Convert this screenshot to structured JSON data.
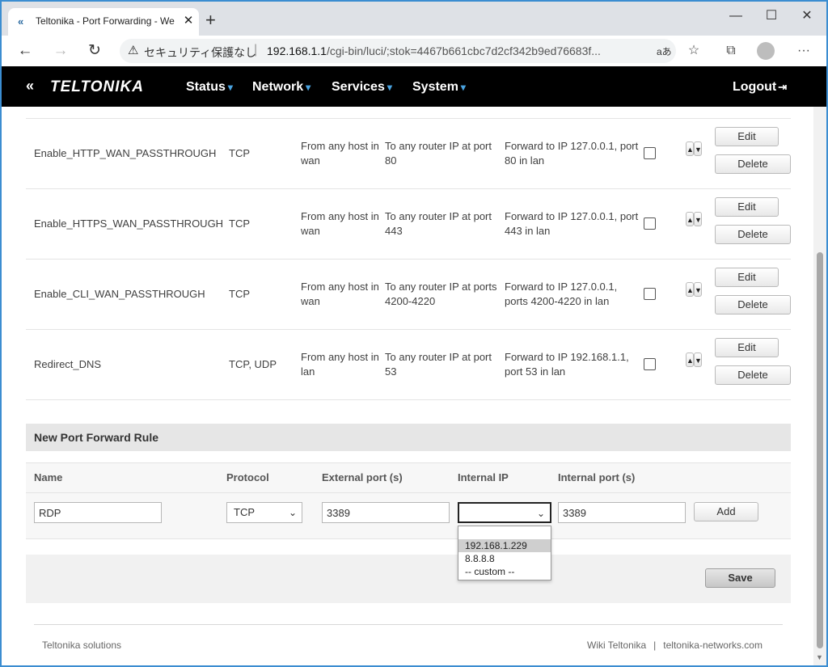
{
  "browser": {
    "tab_title": "Teltonika - Port Forwarding - We",
    "tab_close": "✕",
    "new_tab": "+",
    "window_minimize": "—",
    "window_maximize": "☐",
    "window_close": "✕",
    "nav_back": "←",
    "nav_forward": "→",
    "nav_reload": "↻",
    "security_warning": "⚠",
    "security_text": "セキュリティ保護なし",
    "address_separator": "|",
    "url_host": "192.168.1.1",
    "url_path": "/cgi-bin/luci/;stok=4467b661cbc7d2cf342b9ed76683f...",
    "read_aloud": "aあ",
    "favorites_icon": "☆",
    "collections_icon": "⧉",
    "more_icon": "···"
  },
  "router": {
    "logo_mark": "«",
    "logo": "TELTONIKA",
    "menu": [
      {
        "label": "Status"
      },
      {
        "label": "Network"
      },
      {
        "label": "Services"
      },
      {
        "label": "System"
      }
    ],
    "menu_caret": "▾",
    "logout": "Logout"
  },
  "rules": [
    {
      "name": "Enable_HTTP_WAN_PASSTHROUGH",
      "protocol": "TCP",
      "source": "From any host in wan",
      "destination": "To any router IP at port 80",
      "forward": "Forward to IP 127.0.0.1, port 80 in lan"
    },
    {
      "name": "Enable_HTTPS_WAN_PASSTHROUGH",
      "protocol": "TCP",
      "source": "From any host in wan",
      "destination": "To any router IP at port 443",
      "forward": "Forward to IP 127.0.0.1, port 443 in lan"
    },
    {
      "name": "Enable_CLI_WAN_PASSTHROUGH",
      "protocol": "TCP",
      "source": "From any host in wan",
      "destination": "To any router IP at ports 4200-4220",
      "forward": "Forward to IP 127.0.0.1, ports 4200-4220 in lan"
    },
    {
      "name": "Redirect_DNS",
      "protocol": "TCP, UDP",
      "source": "From any host in lan",
      "destination": "To any router IP at port 53",
      "forward": "Forward to IP 192.168.1.1, port 53 in lan"
    }
  ],
  "rule_buttons": {
    "edit": "Edit",
    "delete": "Delete",
    "up": "▲",
    "down": "▼"
  },
  "new_rule": {
    "title": "New Port Forward Rule",
    "headers": {
      "name": "Name",
      "protocol": "Protocol",
      "external_port": "External port (s)",
      "internal_ip": "Internal IP",
      "internal_port": "Internal port (s)"
    },
    "name_value": "RDP",
    "protocol_value": "TCP",
    "external_port_value": "3389",
    "internal_ip_value": "",
    "internal_port_value": "3389",
    "add_label": "Add",
    "select_chevron": "⌄",
    "internal_ip_options": [
      "",
      "192.168.1.229",
      "8.8.8.8",
      "-- custom --"
    ],
    "highlighted_option": "192.168.1.229"
  },
  "save_label": "Save",
  "footer": {
    "left": "Teltonika solutions",
    "wiki": "Wiki Teltonika",
    "separator": "|",
    "site": "teltonika-networks.com"
  }
}
